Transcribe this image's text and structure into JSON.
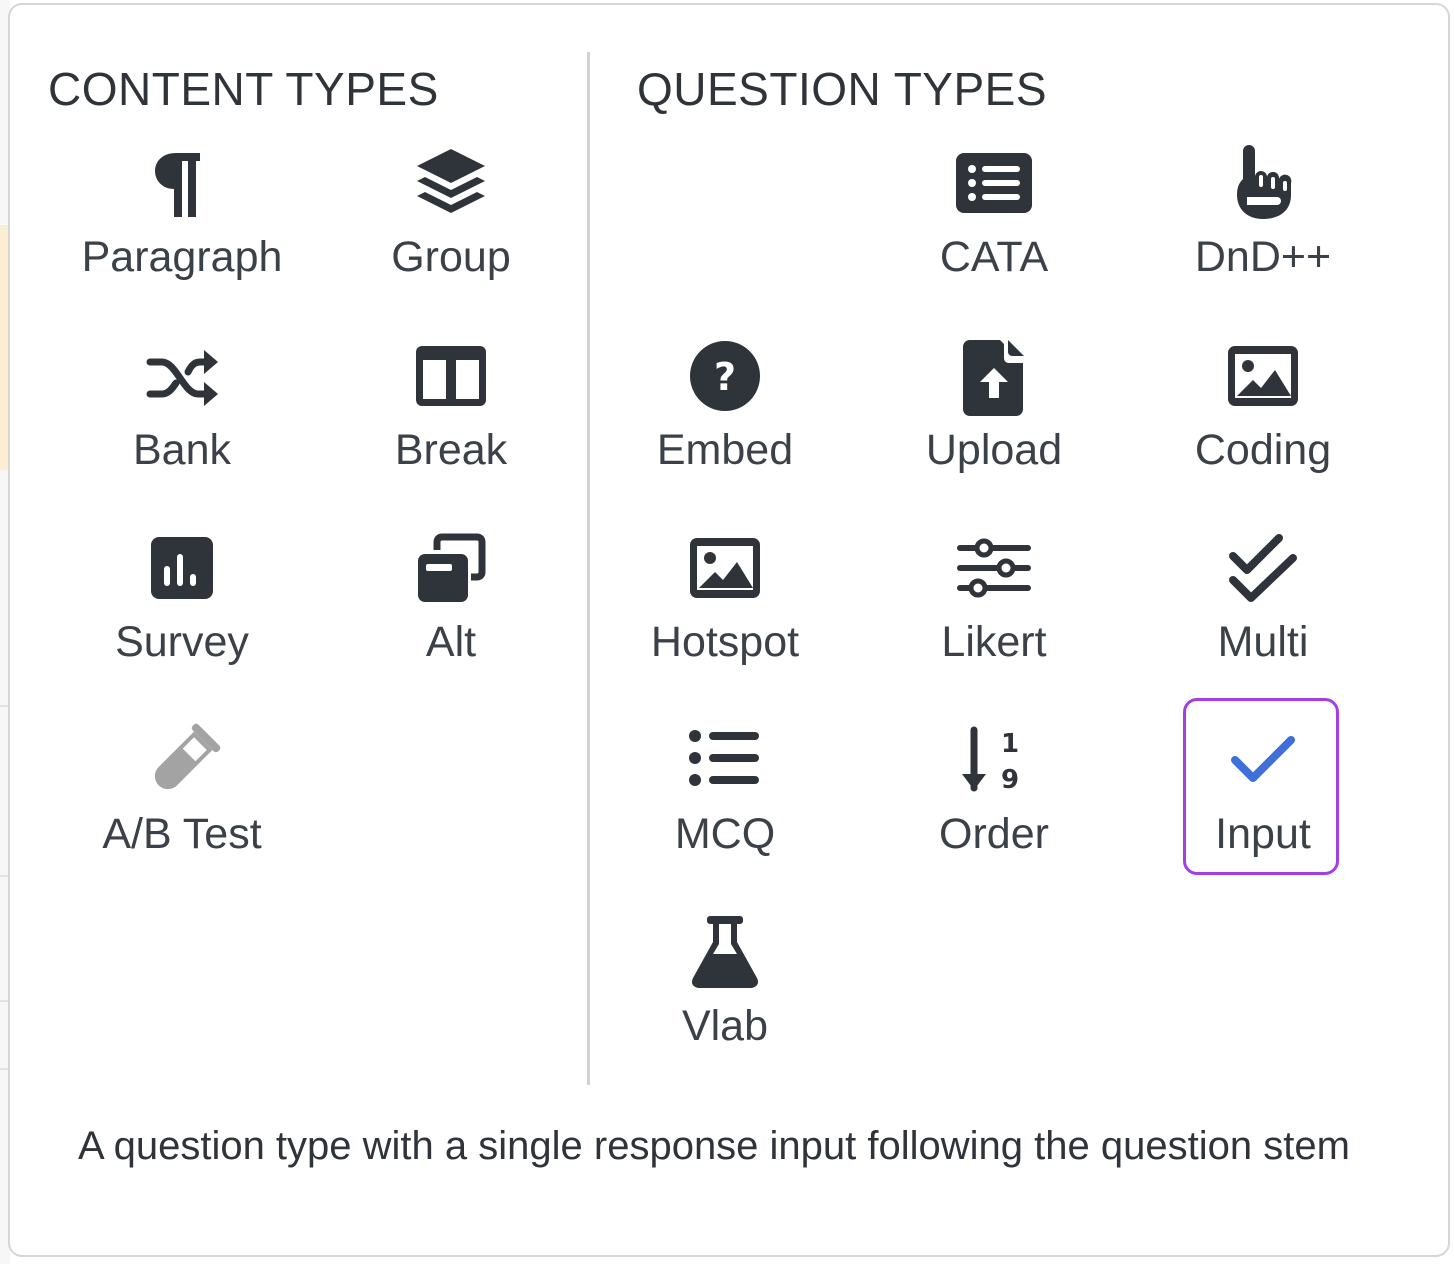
{
  "content_types": {
    "title": "CONTENT TYPES",
    "items": [
      {
        "label": "Paragraph",
        "icon": "paragraph-icon"
      },
      {
        "label": "Group",
        "icon": "layers-icon"
      },
      {
        "label": "Bank",
        "icon": "shuffle-icon"
      },
      {
        "label": "Break",
        "icon": "columns-icon"
      },
      {
        "label": "Survey",
        "icon": "bar-chart-icon"
      },
      {
        "label": "Alt",
        "icon": "window-restore-icon"
      },
      {
        "label": "A/B Test",
        "icon": "test-tube-icon",
        "disabled": true
      }
    ]
  },
  "question_types": {
    "title": "QUESTION TYPES",
    "items": [
      {
        "label": "CATA",
        "icon": "list-icon"
      },
      {
        "label": "DnD++",
        "icon": "hand-pointer-icon"
      },
      {
        "label": "Embed",
        "icon": "question-circle-icon"
      },
      {
        "label": "Upload",
        "icon": "file-upload-icon"
      },
      {
        "label": "Coding",
        "icon": "image-icon"
      },
      {
        "label": "Hotspot",
        "icon": "image-icon"
      },
      {
        "label": "Likert",
        "icon": "sliders-icon"
      },
      {
        "label": "Multi",
        "icon": "double-check-icon"
      },
      {
        "label": "MCQ",
        "icon": "list-ul-icon"
      },
      {
        "label": "Order",
        "icon": "sort-numeric-icon"
      },
      {
        "label": "Input",
        "icon": "check-icon",
        "selected": true
      },
      {
        "label": "Vlab",
        "icon": "flask-icon"
      }
    ]
  },
  "description": "A question type with a single response input following the question stem",
  "colors": {
    "icon": "#2f343b",
    "icon_disabled": "#a3a3a3",
    "check_accent": "#3f6fd8",
    "selected_border": "#a63fe0"
  }
}
